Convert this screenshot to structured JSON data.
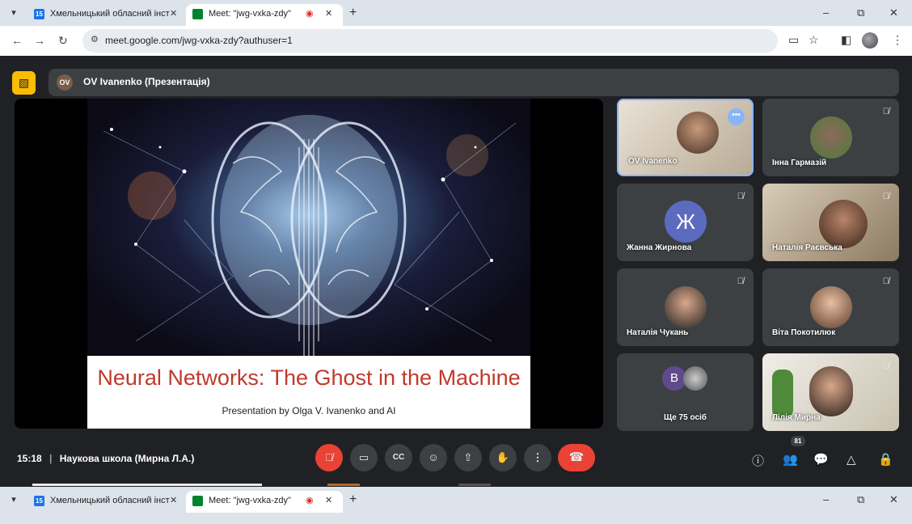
{
  "browser": {
    "tabs": [
      {
        "favicon": "calendar-icon",
        "favicon_text": "15",
        "title": "Хмельницький обласний інсти",
        "close": "✕"
      },
      {
        "favicon": "meet-icon",
        "title": "Meet: \"jwg-vxka-zdy\"",
        "recording": "◉",
        "close": "✕"
      }
    ],
    "new_tab": "+",
    "url": "meet.google.com/jwg-vxka-zdy?authuser=1",
    "window_controls": {
      "minimize": "–",
      "restore": "⧉",
      "close": "✕"
    }
  },
  "meet": {
    "presenter": {
      "initials": "OV",
      "label": "OV Ivanenko (Презентація)"
    },
    "slide": {
      "title": "Neural Networks: The Ghost in the Machine",
      "subtitle": "Presentation by Olga V. Ivanenko and AI"
    },
    "participants": [
      {
        "name": "OV Ivanenko",
        "more": "•••"
      },
      {
        "name": "Інна Гармазій",
        "mute": "mic-off-icon"
      },
      {
        "name": "Жанна Жирнова",
        "letter": "Ж",
        "mute": "mic-off-icon"
      },
      {
        "name": "Наталія Раєвська",
        "mute": "mic-off-icon"
      },
      {
        "name": "Наталія Чукань",
        "mute": "mic-off-icon"
      },
      {
        "name": "Віта Покотилюк",
        "mute": "mic-off-icon"
      },
      {
        "name": "Ще 75 осіб",
        "letter": "В"
      },
      {
        "name": "Лілія Мирна",
        "mute": "mic-off-icon"
      }
    ],
    "bottom": {
      "time": "15:18",
      "meeting": "Наукова школа (Мирна Л.А.)",
      "people_count": "81"
    },
    "colors": {
      "accent": "#fbbc04",
      "end_call": "#ea4335",
      "tile": "#3c4043",
      "bg": "#202124"
    }
  }
}
